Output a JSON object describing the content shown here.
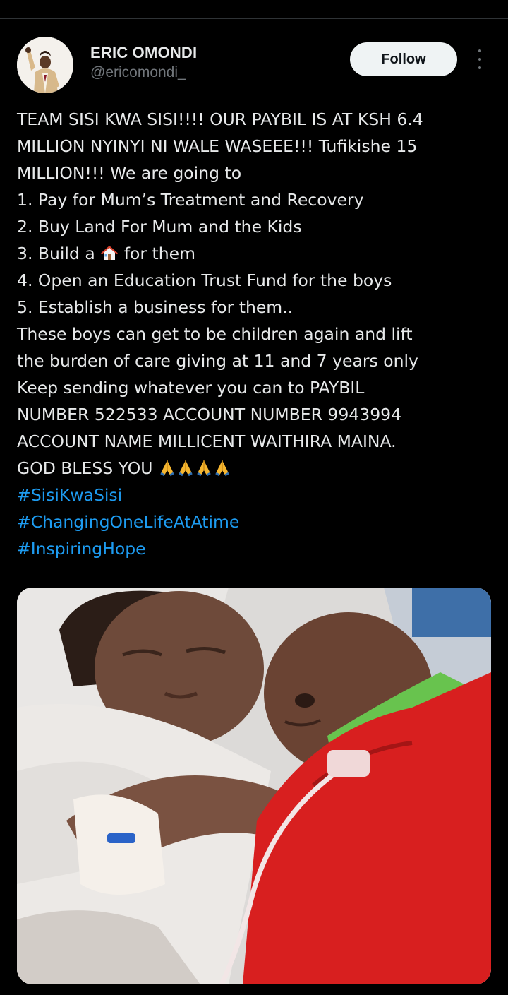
{
  "author": {
    "display_name": "ERIC OMONDI",
    "handle": "@ericomondi_"
  },
  "follow_label": "Follow",
  "post": {
    "lines": [
      "TEAM SISI KWA SISI!!!! OUR PAYBIL IS AT KSH 6.4",
      "MILLION NYINYI NI WALE WASEEE!!! Tufikishe 15",
      "MILLION!!! We are going to",
      "1. Pay for Mum’s Treatment and Recovery",
      "2. Buy Land For Mum and the Kids"
    ],
    "line_build_prefix": "3. Build a",
    "line_build_suffix": "for them",
    "lines_after": [
      "4. Open an Education Trust Fund for the boys",
      "5. Establish a business for them..",
      "These boys can get to be children again and lift",
      "the burden of care giving at 11 and 7 years only",
      "Keep sending whatever you can to PAYBIL",
      "NUMBER 522533 ACCOUNT NUMBER 9943994",
      "ACCOUNT NAME MILLICENT WAITHIRA MAINA."
    ],
    "closing": "GOD BLESS YOU",
    "hashtags": [
      "#SisiKwaSisi",
      "#ChangingOneLifeAtAtime",
      "#InspiringHope"
    ]
  },
  "icons": {
    "more": "more-vertical-icon",
    "house": "house-emoji",
    "pray": "folded-hands-emoji"
  },
  "colors": {
    "background": "#000000",
    "text": "#e7e9ea",
    "muted": "#71767b",
    "link": "#1d9bf0",
    "follow_bg": "#eff3f4"
  }
}
